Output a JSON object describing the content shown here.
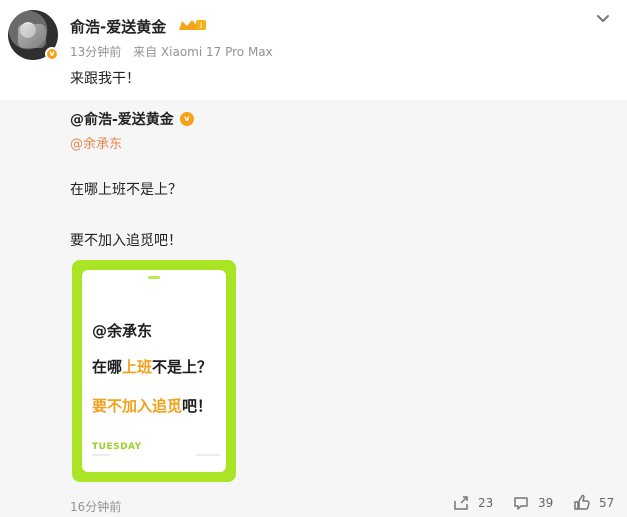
{
  "post": {
    "username": "俞浩-爱送黄金",
    "level_badge": "I",
    "time_ago": "13分钟前",
    "source": "来自 Xiaomi 17 Pro Max",
    "text": "来跟我干！"
  },
  "repost": {
    "author": "@俞浩-爱送黄金",
    "mention": "@余承东",
    "line1": "在哪上班不是上？",
    "line2": "要不加入追觅吧！",
    "poster": {
      "mention": "@余承东",
      "line1_part1": "在哪",
      "line1_highlight": "上班",
      "line1_part2": "不是上？",
      "line2_highlight": "要不加入追觅",
      "line2_part2": "吧！",
      "day": "TUESDAY"
    },
    "time_ago": "16分钟前",
    "actions": {
      "share_count": "23",
      "comment_count": "39",
      "like_count": "57"
    }
  },
  "colors": {
    "accent_orange": "#e8874d",
    "badge_gold": "#f7a21b",
    "poster_green": "#a9e524",
    "text_dark": "#222222",
    "meta_gray": "#939393"
  },
  "icons": {
    "avatar_badge": "verified-badge-icon",
    "crown": "crown-icon",
    "chevron": "chevron-down-icon",
    "share": "share-icon",
    "comment": "comment-icon",
    "like": "like-icon"
  }
}
